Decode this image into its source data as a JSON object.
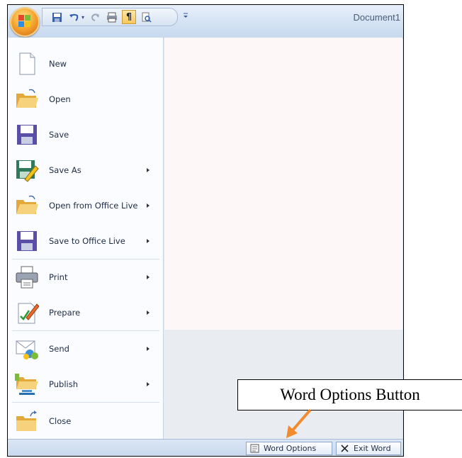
{
  "window": {
    "document_title": "Document1"
  },
  "quick_access_toolbar": {
    "buttons": [
      "save-icon",
      "undo-icon",
      "undo-dropdown-icon",
      "redo-icon",
      "print-icon",
      "pilcrow-icon",
      "print-preview-icon"
    ],
    "pilcrow_glyph": "¶"
  },
  "menu": {
    "items": [
      {
        "label": "New",
        "icon": "new-document-icon",
        "submenu": false
      },
      {
        "label": "Open",
        "icon": "folder-open-icon",
        "submenu": false
      },
      {
        "label": "Save",
        "icon": "save-icon",
        "submenu": false
      },
      {
        "label": "Save As",
        "icon": "save-as-icon",
        "submenu": true
      },
      {
        "label": "Open from Office Live",
        "icon": "folder-open-icon",
        "submenu": true
      },
      {
        "label": "Save to Office Live",
        "icon": "save-icon",
        "submenu": true
      },
      {
        "label": "Print",
        "icon": "printer-icon",
        "submenu": true
      },
      {
        "label": "Prepare",
        "icon": "prepare-icon",
        "submenu": true
      },
      {
        "label": "Send",
        "icon": "send-icon",
        "submenu": true
      },
      {
        "label": "Publish",
        "icon": "publish-icon",
        "submenu": true
      },
      {
        "label": "Close",
        "icon": "close-folder-icon",
        "submenu": false
      }
    ]
  },
  "bottom_buttons": {
    "word_options": "Word Options",
    "exit_word": "Exit Word"
  },
  "annotation": {
    "callout_text": "Word Options Button",
    "arrow_color": "#f28a2e"
  },
  "colors": {
    "office_button": "#f6a531",
    "menu_background": "#fafcff",
    "ribbon_blue": "#d6e3f4"
  }
}
